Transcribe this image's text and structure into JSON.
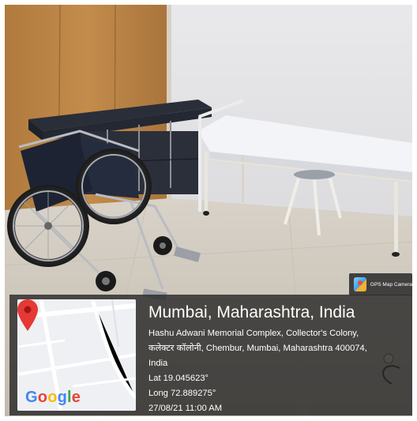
{
  "badge": {
    "label": "GPS Map Camera",
    "icon": "gps-map-camera-app-icon"
  },
  "map": {
    "logo_text": "Google",
    "logo_colors": [
      "#4285F4",
      "#EA4335",
      "#FBBC05",
      "#4285F4",
      "#34A853",
      "#EA4335"
    ],
    "pin_color": "#E53935",
    "icon": "location-pin-icon"
  },
  "location": {
    "title": "Mumbai, Maharashtra, India",
    "address_line1": "Hashu Adwani Memorial Complex, Collector's Colony,",
    "address_line2": "कलेक्टर कॉलोनी, Chembur, Mumbai, Maharashtra 400074,",
    "address_line3": "India",
    "latitude": "Lat 19.045623°",
    "longitude": "Long 72.889275°",
    "datetime": "27/08/21 11:00 AM"
  }
}
